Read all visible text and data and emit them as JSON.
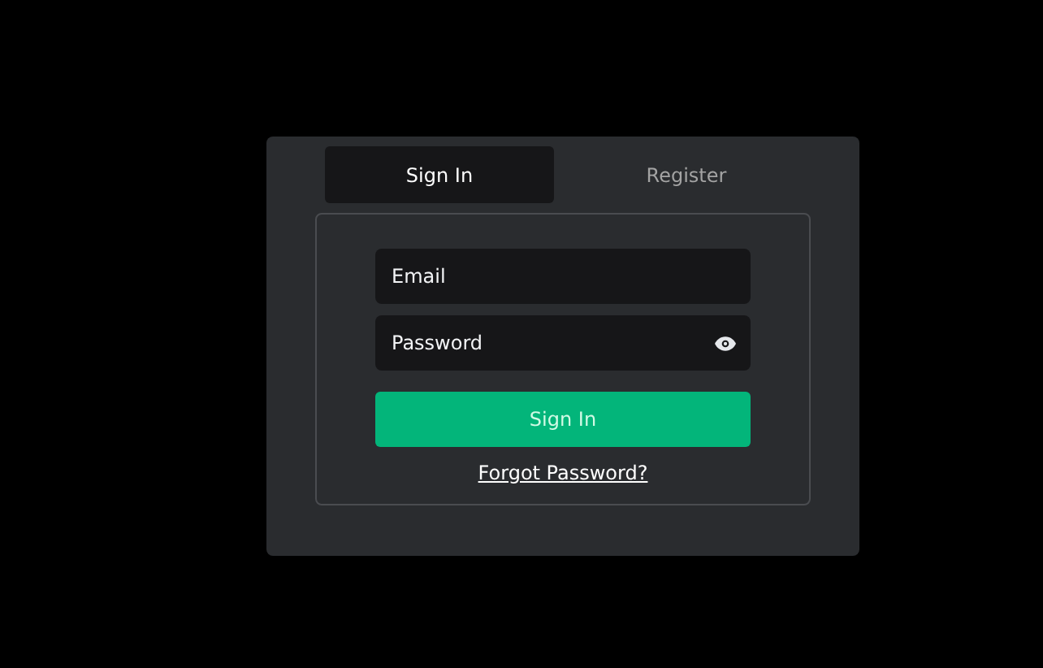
{
  "tabs": [
    {
      "label": "Sign In",
      "selected": true
    },
    {
      "label": "Register",
      "selected": false
    }
  ],
  "form": {
    "fields": [
      {
        "placeholder": "Email",
        "kind": "text"
      },
      {
        "placeholder": "Password",
        "kind": "password"
      }
    ],
    "submit": "Sign In",
    "link": "Forgot Password?"
  }
}
